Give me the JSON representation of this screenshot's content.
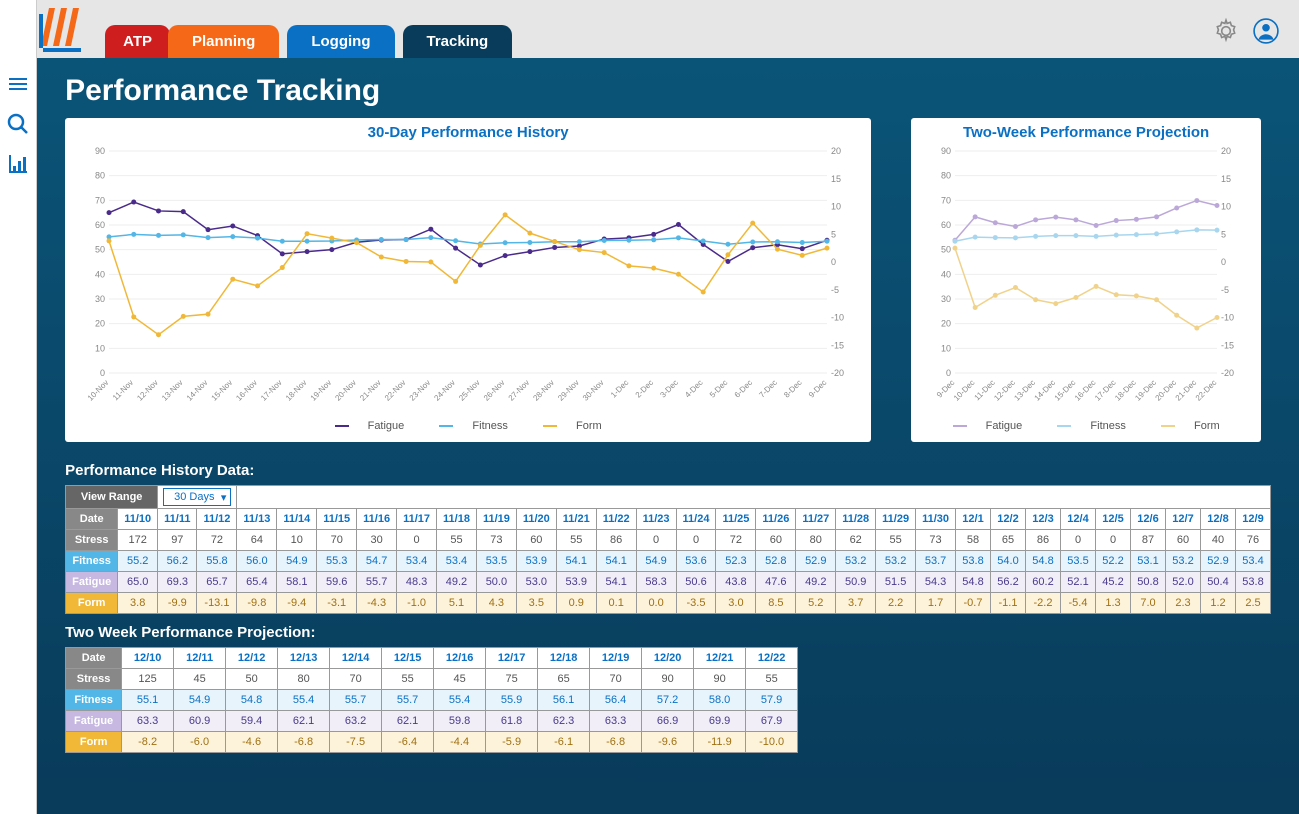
{
  "tabs": {
    "atp": "ATP",
    "planning": "Planning",
    "logging": "Logging",
    "tracking": "Tracking"
  },
  "page_title": "Performance Tracking",
  "chart_history_title": "30-Day Performance History",
  "chart_projection_title": "Two-Week Performance Projection",
  "legend": {
    "fatigue": "Fatigue",
    "fitness": "Fitness",
    "form": "Form"
  },
  "history_section_title": "Performance History Data:",
  "projection_section_title": "Two Week Performance Projection:",
  "view_range_label": "View Range",
  "view_range_value": "30 Days",
  "row_labels": {
    "date": "Date",
    "stress": "Stress",
    "fitness": "Fitness",
    "fatigue": "Fatigue",
    "form": "Form"
  },
  "history": {
    "dates": [
      "11/10",
      "11/11",
      "11/12",
      "11/13",
      "11/14",
      "11/15",
      "11/16",
      "11/17",
      "11/18",
      "11/19",
      "11/20",
      "11/21",
      "11/22",
      "11/23",
      "11/24",
      "11/25",
      "11/26",
      "11/27",
      "11/28",
      "11/29",
      "11/30",
      "12/1",
      "12/2",
      "12/3",
      "12/4",
      "12/5",
      "12/6",
      "12/7",
      "12/8",
      "12/9"
    ],
    "stress": [
      172,
      97,
      72,
      64,
      10,
      70,
      30,
      0,
      55,
      73,
      60,
      55,
      86,
      0,
      0,
      72,
      60,
      80,
      62,
      55,
      73,
      58,
      65,
      86,
      0,
      0,
      87,
      60,
      40,
      76
    ],
    "fitness": [
      55.2,
      56.2,
      55.8,
      56.0,
      54.9,
      55.3,
      54.7,
      53.4,
      53.4,
      53.5,
      53.9,
      54.1,
      54.1,
      54.9,
      53.6,
      52.3,
      52.8,
      52.9,
      53.2,
      53.2,
      53.7,
      53.8,
      54.0,
      54.8,
      53.5,
      52.2,
      53.1,
      53.2,
      52.9,
      53.4
    ],
    "fatigue": [
      65.0,
      69.3,
      65.7,
      65.4,
      58.1,
      59.6,
      55.7,
      48.3,
      49.2,
      50.0,
      53.0,
      53.9,
      54.1,
      58.3,
      50.6,
      43.8,
      47.6,
      49.2,
      50.9,
      51.5,
      54.3,
      54.8,
      56.2,
      60.2,
      52.1,
      45.2,
      50.8,
      52.0,
      50.4,
      53.8
    ],
    "form": [
      3.8,
      -9.9,
      -13.1,
      -9.8,
      -9.4,
      -3.1,
      -4.3,
      -1.0,
      5.1,
      4.3,
      3.5,
      0.9,
      0.1,
      0.0,
      -3.5,
      3.0,
      8.5,
      5.2,
      3.7,
      2.2,
      1.7,
      -0.7,
      -1.1,
      -2.2,
      -5.4,
      1.3,
      7.0,
      2.3,
      1.2,
      2.5
    ]
  },
  "projection": {
    "dates": [
      "12/10",
      "12/11",
      "12/12",
      "12/13",
      "12/14",
      "12/15",
      "12/16",
      "12/17",
      "12/18",
      "12/19",
      "12/20",
      "12/21",
      "12/22"
    ],
    "stress": [
      125,
      45,
      50,
      80,
      70,
      55,
      45,
      75,
      65,
      70,
      90,
      90,
      55
    ],
    "fitness": [
      55.1,
      54.9,
      54.8,
      55.4,
      55.7,
      55.7,
      55.4,
      55.9,
      56.1,
      56.4,
      57.2,
      58.0,
      57.9
    ],
    "fatigue": [
      63.3,
      60.9,
      59.4,
      62.1,
      63.2,
      62.1,
      59.8,
      61.8,
      62.3,
      63.3,
      66.9,
      69.9,
      67.9
    ],
    "form": [
      -8.2,
      -6.0,
      -4.6,
      -6.8,
      -7.5,
      -6.4,
      -4.4,
      -5.9,
      -6.1,
      -6.8,
      -9.6,
      -11.9,
      -10.0
    ]
  },
  "chart_data": [
    {
      "type": "line",
      "title": "30-Day Performance History",
      "categories": [
        "10-Nov",
        "11-Nov",
        "12-Nov",
        "13-Nov",
        "14-Nov",
        "15-Nov",
        "16-Nov",
        "17-Nov",
        "18-Nov",
        "19-Nov",
        "20-Nov",
        "21-Nov",
        "22-Nov",
        "23-Nov",
        "24-Nov",
        "25-Nov",
        "26-Nov",
        "27-Nov",
        "28-Nov",
        "29-Nov",
        "30-Nov",
        "1-Dec",
        "2-Dec",
        "3-Dec",
        "4-Dec",
        "5-Dec",
        "6-Dec",
        "7-Dec",
        "8-Dec",
        "9-Dec"
      ],
      "ylim_left": [
        0,
        90
      ],
      "ylim_right": [
        -20,
        20
      ],
      "series": [
        {
          "name": "Fatigue",
          "axis": "left",
          "values": [
            65.0,
            69.3,
            65.7,
            65.4,
            58.1,
            59.6,
            55.7,
            48.3,
            49.2,
            50.0,
            53.0,
            53.9,
            54.1,
            58.3,
            50.6,
            43.8,
            47.6,
            49.2,
            50.9,
            51.5,
            54.3,
            54.8,
            56.2,
            60.2,
            52.1,
            45.2,
            50.8,
            52.0,
            50.4,
            53.8
          ]
        },
        {
          "name": "Fitness",
          "axis": "left",
          "values": [
            55.2,
            56.2,
            55.8,
            56.0,
            54.9,
            55.3,
            54.7,
            53.4,
            53.4,
            53.5,
            53.9,
            54.1,
            54.1,
            54.9,
            53.6,
            52.3,
            52.8,
            52.9,
            53.2,
            53.2,
            53.7,
            53.8,
            54.0,
            54.8,
            53.5,
            52.2,
            53.1,
            53.2,
            52.9,
            53.4
          ]
        },
        {
          "name": "Form",
          "axis": "right",
          "values": [
            3.8,
            -9.9,
            -13.1,
            -9.8,
            -9.4,
            -3.1,
            -4.3,
            -1.0,
            5.1,
            4.3,
            3.5,
            0.9,
            0.1,
            0.0,
            -3.5,
            3.0,
            8.5,
            5.2,
            3.7,
            2.2,
            1.7,
            -0.7,
            -1.1,
            -2.2,
            -5.4,
            1.3,
            7.0,
            2.3,
            1.2,
            2.5
          ]
        }
      ]
    },
    {
      "type": "line",
      "title": "Two-Week Performance Projection",
      "categories": [
        "9-Dec",
        "10-Dec",
        "11-Dec",
        "12-Dec",
        "13-Dec",
        "14-Dec",
        "15-Dec",
        "16-Dec",
        "17-Dec",
        "18-Dec",
        "19-Dec",
        "20-Dec",
        "21-Dec",
        "22-Dec"
      ],
      "ylim_left": [
        0,
        90
      ],
      "ylim_right": [
        -20,
        20
      ],
      "series": [
        {
          "name": "Fatigue",
          "axis": "left",
          "values": [
            53.8,
            63.3,
            60.9,
            59.4,
            62.1,
            63.2,
            62.1,
            59.8,
            61.8,
            62.3,
            63.3,
            66.9,
            69.9,
            67.9
          ]
        },
        {
          "name": "Fitness",
          "axis": "left",
          "values": [
            53.4,
            55.1,
            54.9,
            54.8,
            55.4,
            55.7,
            55.7,
            55.4,
            55.9,
            56.1,
            56.4,
            57.2,
            58.0,
            57.9
          ]
        },
        {
          "name": "Form",
          "axis": "right",
          "values": [
            2.5,
            -8.2,
            -6.0,
            -4.6,
            -6.8,
            -7.5,
            -6.4,
            -4.4,
            -5.9,
            -6.1,
            -6.8,
            -9.6,
            -11.9,
            -10.0
          ]
        }
      ]
    }
  ]
}
